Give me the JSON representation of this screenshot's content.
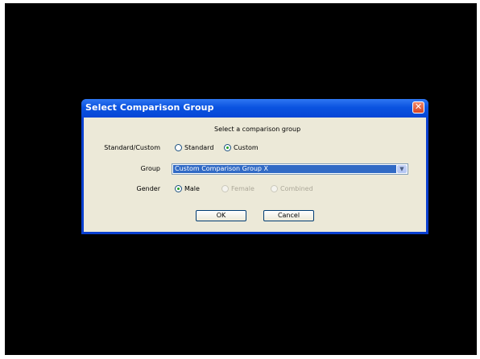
{
  "dialog": {
    "title": "Select Comparison Group",
    "close_icon": "close-icon",
    "prompt": "Select a comparison group",
    "standard_custom": {
      "label": "Standard/Custom",
      "options": [
        {
          "label": "Standard",
          "checked": false,
          "enabled": true
        },
        {
          "label": "Custom",
          "checked": true,
          "enabled": true
        }
      ]
    },
    "group": {
      "label": "Group",
      "selected": "Custom Comparison Group X"
    },
    "gender": {
      "label": "Gender",
      "options": [
        {
          "label": "Male",
          "checked": true,
          "enabled": true
        },
        {
          "label": "Female",
          "checked": false,
          "enabled": false
        },
        {
          "label": "Combined",
          "checked": false,
          "enabled": false
        }
      ]
    },
    "ok_label": "OK",
    "cancel_label": "Cancel"
  },
  "colors": {
    "screen_bg": "#000000",
    "titlebar": "#0b53e0",
    "dialog_body": "#ece9d8",
    "selection": "#316ac5"
  }
}
